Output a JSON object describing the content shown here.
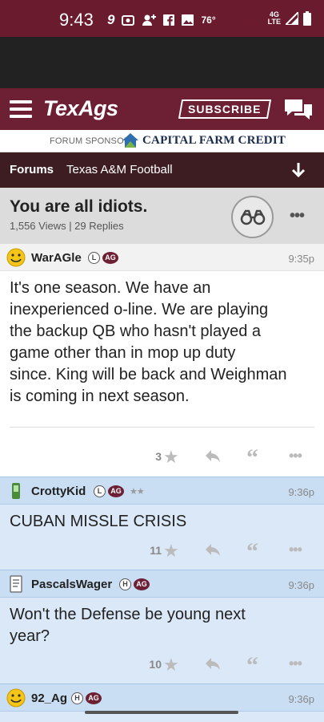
{
  "status_bar": {
    "time": "9:43",
    "temp": "76°",
    "network": "4G LTE"
  },
  "nav": {
    "logo": "TexAgs",
    "subscribe_label": "SUBSCRIBE"
  },
  "sponsor": {
    "label": "FORUM SPONSOR",
    "name": "CAPITAL FARM CREDIT"
  },
  "breadcrumb": {
    "forums": "Forums",
    "board": "Texas A&M Football"
  },
  "thread": {
    "title": "You are all idiots.",
    "meta": "1,556 Views | 29 Replies"
  },
  "posts": [
    {
      "user": "WarAGle",
      "badge1": "L",
      "badge2": "AG",
      "time": "9:35p",
      "lines": [
        "It's one season. We have an",
        "inexperienced o-line. We are playing",
        "the backup QB who hasn't played a",
        "game other than in mop up duty",
        "since. King will be back and Weighman",
        "is coming in next season."
      ],
      "stars": "3"
    },
    {
      "user": "CrottyKid",
      "badge1": "L",
      "badge2": "AG",
      "rank": "★★",
      "time": "9:36p",
      "lines": [
        "CUBAN MISSLE CRISIS"
      ],
      "stars": "11"
    },
    {
      "user": "PascalsWager",
      "badge1": "H",
      "badge2": "AG",
      "time": "9:36p",
      "lines": [
        "Won't the Defense be young next",
        "year?"
      ],
      "stars": "10"
    },
    {
      "user": "92_Ag",
      "badge1": "H",
      "badge2": "AG",
      "time": "9:36p"
    }
  ],
  "colors": {
    "maroon": "#6d1f33",
    "forum_bar": "#3d1d22",
    "reply_bg": "#dbe8f7"
  }
}
